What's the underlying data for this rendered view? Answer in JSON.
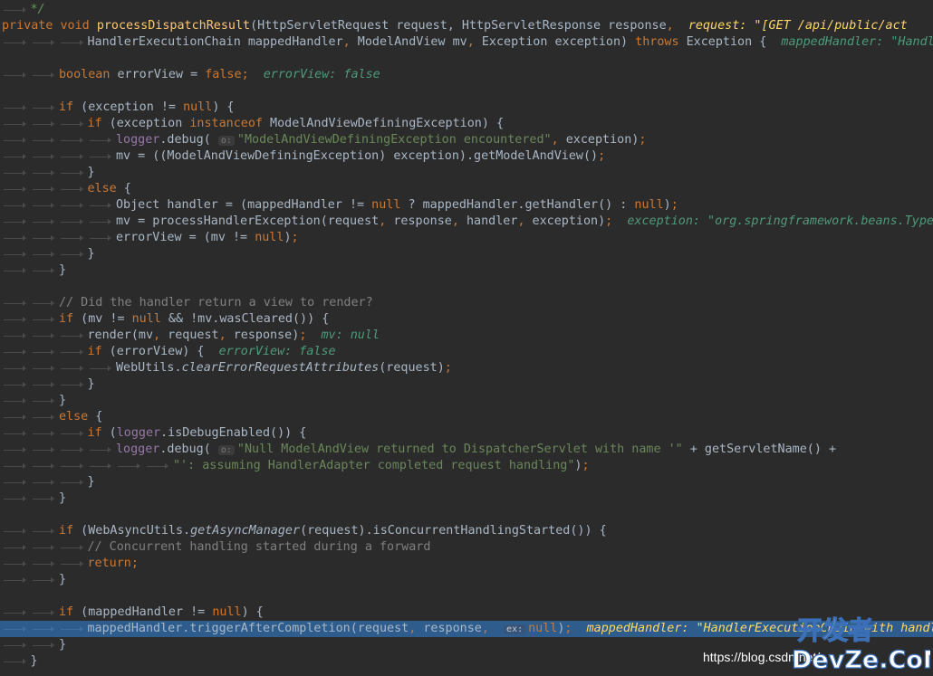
{
  "colors": {
    "background": "#2b2b2b",
    "keyword": "#cc7832",
    "method": "#ffc66d",
    "string": "#6a8759",
    "comment": "#808080",
    "field": "#9876aa",
    "inline_value": "#4e9a7a",
    "current_line": "#2d5c8d"
  },
  "lines": [
    {
      "indent": 1,
      "tokens": [
        {
          "t": "*/",
          "c": "c-doc"
        }
      ]
    },
    {
      "indent": 0,
      "tokens": [
        {
          "t": "private",
          "c": "c-kw"
        },
        {
          "t": " "
        },
        {
          "t": "void",
          "c": "c-kw"
        },
        {
          "t": " "
        },
        {
          "t": "processDispatchResult",
          "c": "c-fn"
        },
        {
          "t": "(HttpServletRequest request, HttpServletResponse response"
        },
        {
          "t": ",",
          "c": "c-kw"
        },
        {
          "t": "  "
        },
        {
          "t": "request: \"[GET /api/public/act",
          "c": "c-valhl"
        }
      ]
    },
    {
      "indent": 3,
      "tokens": [
        {
          "t": "HandlerExecutionChain mappedHandler"
        },
        {
          "t": ",",
          "c": "c-kw"
        },
        {
          "t": " ModelAndView mv"
        },
        {
          "t": ",",
          "c": "c-kw"
        },
        {
          "t": " Exception exception) "
        },
        {
          "t": "throws",
          "c": "c-kw"
        },
        {
          "t": " Exception {  "
        },
        {
          "t": "mappedHandler: \"Handle",
          "c": "c-val"
        }
      ]
    },
    {
      "indent": 0,
      "tokens": []
    },
    {
      "indent": 2,
      "tokens": [
        {
          "t": "boolean",
          "c": "c-kw"
        },
        {
          "t": " errorView = "
        },
        {
          "t": "false",
          "c": "c-kw"
        },
        {
          "t": ";",
          "c": "c-kw"
        },
        {
          "t": "  "
        },
        {
          "t": "errorView: false",
          "c": "c-val"
        }
      ]
    },
    {
      "indent": 0,
      "tokens": []
    },
    {
      "indent": 2,
      "tokens": [
        {
          "t": "if",
          "c": "c-kw"
        },
        {
          "t": " (exception != "
        },
        {
          "t": "null",
          "c": "c-kw"
        },
        {
          "t": ") {"
        }
      ]
    },
    {
      "indent": 3,
      "tokens": [
        {
          "t": "if",
          "c": "c-kw"
        },
        {
          "t": " (exception "
        },
        {
          "t": "instanceof",
          "c": "c-kw"
        },
        {
          "t": " ModelAndViewDefiningException) {"
        }
      ]
    },
    {
      "indent": 4,
      "tokens": [
        {
          "t": "logger",
          "c": "c-fld"
        },
        {
          "t": ".debug( "
        },
        {
          "t": "o:",
          "c": "c-hint"
        },
        {
          "t": "\"ModelAndViewDefiningException encountered\"",
          "c": "c-str"
        },
        {
          "t": ",",
          "c": "c-kw"
        },
        {
          "t": " exception)"
        },
        {
          "t": ";",
          "c": "c-kw"
        }
      ]
    },
    {
      "indent": 4,
      "tokens": [
        {
          "t": "mv = ((ModelAndViewDefiningException) exception).getModelAndView()"
        },
        {
          "t": ";",
          "c": "c-kw"
        }
      ]
    },
    {
      "indent": 3,
      "tokens": [
        {
          "t": "}"
        }
      ]
    },
    {
      "indent": 3,
      "tokens": [
        {
          "t": "else",
          "c": "c-kw"
        },
        {
          "t": " {"
        }
      ]
    },
    {
      "indent": 4,
      "tokens": [
        {
          "t": "Object handler = (mappedHandler != "
        },
        {
          "t": "null",
          "c": "c-kw"
        },
        {
          "t": " ? mappedHandler.getHandler() : "
        },
        {
          "t": "null",
          "c": "c-kw"
        },
        {
          "t": ")"
        },
        {
          "t": ";",
          "c": "c-kw"
        }
      ]
    },
    {
      "indent": 4,
      "tokens": [
        {
          "t": "mv = processHandlerException(request"
        },
        {
          "t": ",",
          "c": "c-kw"
        },
        {
          "t": " response"
        },
        {
          "t": ",",
          "c": "c-kw"
        },
        {
          "t": " handler"
        },
        {
          "t": ",",
          "c": "c-kw"
        },
        {
          "t": " exception)"
        },
        {
          "t": ";",
          "c": "c-kw"
        },
        {
          "t": "  "
        },
        {
          "t": "exception: \"org.springframework.beans.TypeM",
          "c": "c-val"
        }
      ]
    },
    {
      "indent": 4,
      "tokens": [
        {
          "t": "errorView = (mv != "
        },
        {
          "t": "null",
          "c": "c-kw"
        },
        {
          "t": ")"
        },
        {
          "t": ";",
          "c": "c-kw"
        }
      ]
    },
    {
      "indent": 3,
      "tokens": [
        {
          "t": "}"
        }
      ]
    },
    {
      "indent": 2,
      "tokens": [
        {
          "t": "}"
        }
      ]
    },
    {
      "indent": 0,
      "tokens": []
    },
    {
      "indent": 2,
      "tokens": [
        {
          "t": "// Did the handler return a view to render?",
          "c": "c-cmt"
        }
      ]
    },
    {
      "indent": 2,
      "tokens": [
        {
          "t": "if",
          "c": "c-kw"
        },
        {
          "t": " (mv != "
        },
        {
          "t": "null",
          "c": "c-kw"
        },
        {
          "t": " && !mv.wasCleared()) {"
        }
      ]
    },
    {
      "indent": 3,
      "tokens": [
        {
          "t": "render(mv"
        },
        {
          "t": ",",
          "c": "c-kw"
        },
        {
          "t": " request"
        },
        {
          "t": ",",
          "c": "c-kw"
        },
        {
          "t": " response)"
        },
        {
          "t": ";",
          "c": "c-kw"
        },
        {
          "t": "  "
        },
        {
          "t": "mv: null",
          "c": "c-val"
        }
      ]
    },
    {
      "indent": 3,
      "tokens": [
        {
          "t": "if",
          "c": "c-kw"
        },
        {
          "t": " (errorView) {  "
        },
        {
          "t": "errorView: false",
          "c": "c-val"
        }
      ]
    },
    {
      "indent": 4,
      "tokens": [
        {
          "t": "WebUtils."
        },
        {
          "t": "clearErrorRequestAttributes",
          "c": "c-it"
        },
        {
          "t": "(request)"
        },
        {
          "t": ";",
          "c": "c-kw"
        }
      ]
    },
    {
      "indent": 3,
      "tokens": [
        {
          "t": "}"
        }
      ]
    },
    {
      "indent": 2,
      "tokens": [
        {
          "t": "}"
        }
      ]
    },
    {
      "indent": 2,
      "tokens": [
        {
          "t": "else",
          "c": "c-kw"
        },
        {
          "t": " {"
        }
      ]
    },
    {
      "indent": 3,
      "tokens": [
        {
          "t": "if",
          "c": "c-kw"
        },
        {
          "t": " ("
        },
        {
          "t": "logger",
          "c": "c-fld"
        },
        {
          "t": ".isDebugEnabled()) {"
        }
      ]
    },
    {
      "indent": 4,
      "tokens": [
        {
          "t": "logger",
          "c": "c-fld"
        },
        {
          "t": ".debug( "
        },
        {
          "t": "o:",
          "c": "c-hint"
        },
        {
          "t": "\"Null ModelAndView returned to DispatcherServlet with name '\"",
          "c": "c-str"
        },
        {
          "t": " + getServletName() +"
        }
      ]
    },
    {
      "indent": 6,
      "tokens": [
        {
          "t": "\"': assuming HandlerAdapter completed request handling\"",
          "c": "c-str"
        },
        {
          "t": ")"
        },
        {
          "t": ";",
          "c": "c-kw"
        }
      ]
    },
    {
      "indent": 3,
      "tokens": [
        {
          "t": "}"
        }
      ]
    },
    {
      "indent": 2,
      "tokens": [
        {
          "t": "}"
        }
      ]
    },
    {
      "indent": 0,
      "tokens": []
    },
    {
      "indent": 2,
      "tokens": [
        {
          "t": "if",
          "c": "c-kw"
        },
        {
          "t": " (WebAsyncUtils."
        },
        {
          "t": "getAsyncManager",
          "c": "c-it"
        },
        {
          "t": "(request).isConcurrentHandlingStarted()) {"
        }
      ]
    },
    {
      "indent": 3,
      "tokens": [
        {
          "t": "// Concurrent handling started during a forward",
          "c": "c-cmt"
        }
      ]
    },
    {
      "indent": 3,
      "tokens": [
        {
          "t": "return",
          "c": "c-kw"
        },
        {
          "t": ";",
          "c": "c-kw"
        }
      ]
    },
    {
      "indent": 2,
      "tokens": [
        {
          "t": "}"
        }
      ]
    },
    {
      "indent": 0,
      "tokens": []
    },
    {
      "indent": 2,
      "tokens": [
        {
          "t": "if",
          "c": "c-kw"
        },
        {
          "t": " (mappedHandler != "
        },
        {
          "t": "null",
          "c": "c-kw"
        },
        {
          "t": ") {"
        }
      ]
    },
    {
      "indent": 3,
      "highlight": true,
      "tokens": [
        {
          "t": "mappedHandler.triggerAfterCompletion(request"
        },
        {
          "t": ",",
          "c": "c-kw"
        },
        {
          "t": " response"
        },
        {
          "t": ",",
          "c": "c-kw"
        },
        {
          "t": "  "
        },
        {
          "t": "ex:",
          "c": "c-hintw"
        },
        {
          "t": "null",
          "c": "c-kw"
        },
        {
          "t": ")"
        },
        {
          "t": ";",
          "c": "c-kw"
        },
        {
          "t": "  "
        },
        {
          "t": "mappedHandler: \"HandlerExecutionChain with handle",
          "c": "c-valhl"
        }
      ]
    },
    {
      "indent": 2,
      "tokens": [
        {
          "t": "}"
        }
      ]
    },
    {
      "indent": 1,
      "tokens": [
        {
          "t": "}"
        }
      ]
    }
  ],
  "watermark": {
    "url_text": "https://blog.csdn.net/",
    "logo_top": "开发者",
    "logo_bottom": "DevZe.CoM"
  }
}
